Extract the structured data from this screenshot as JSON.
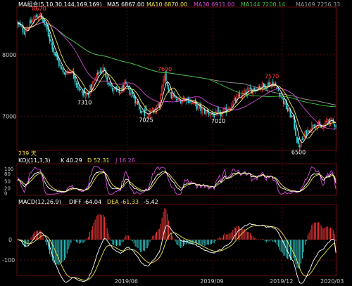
{
  "colors": {
    "up": "#ff3b3b",
    "down": "#36d1d1",
    "ma5": "#ffffff",
    "ma10": "#f0e44a",
    "ma30": "#d34bd3",
    "ma144": "#3fbf3f",
    "ma169": "#9a9a9a",
    "grid": "#5a0b0b",
    "axis_text": "#c8c8c8",
    "k": "#ffffff",
    "d": "#f0e44a",
    "j": "#d34bd3",
    "diff": "#ffffff",
    "dea": "#f0e44a",
    "peak_label": "#ff3b3b",
    "trough_label": "#ffffff"
  },
  "header": {
    "ma": {
      "title": "MA组合(5,10,30,144,169,169)",
      "ma5": "MA5 6867.00",
      "ma10": "MA10 6870.00",
      "ma30": "MA30 6911.00",
      "ma144": "MA144 7200.14",
      "ma169": "MA169 7256.33"
    },
    "kdj": {
      "title": "KDJ(11,3,3)",
      "k": "K 40.29",
      "d": "D 52.31",
      "j": "J 16.26"
    },
    "macd": {
      "title": "MACD(12,26,9)",
      "diff": "DIFF -64.04",
      "dea": "DEA -61.33",
      "macd": "-5.42"
    }
  },
  "bar_count_label": "239 天",
  "chart_data": [
    {
      "type": "candlestick",
      "panel": "price",
      "ylim": [
        6450,
        8750
      ],
      "yticks": [
        7000,
        8000
      ],
      "xticks": [
        "2019/06",
        "2019/09",
        "2019/12",
        "2020/03"
      ],
      "anchor_points": [
        {
          "t": 0,
          "v": 8500
        },
        {
          "t": 5,
          "v": 8380
        },
        {
          "t": 10,
          "v": 8520
        },
        {
          "t": 16,
          "v": 8670
        },
        {
          "t": 22,
          "v": 8400
        },
        {
          "t": 28,
          "v": 8000
        },
        {
          "t": 34,
          "v": 7700
        },
        {
          "t": 40,
          "v": 7750
        },
        {
          "t": 46,
          "v": 7450
        },
        {
          "t": 50,
          "v": 7310
        },
        {
          "t": 56,
          "v": 7500
        },
        {
          "t": 60,
          "v": 7700
        },
        {
          "t": 64,
          "v": 7780
        },
        {
          "t": 70,
          "v": 7450
        },
        {
          "t": 76,
          "v": 7380
        },
        {
          "t": 80,
          "v": 7500
        },
        {
          "t": 86,
          "v": 7350
        },
        {
          "t": 92,
          "v": 7100
        },
        {
          "t": 96,
          "v": 7025
        },
        {
          "t": 102,
          "v": 7100
        },
        {
          "t": 106,
          "v": 7200
        },
        {
          "t": 110,
          "v": 7690
        },
        {
          "t": 114,
          "v": 7350
        },
        {
          "t": 120,
          "v": 7250
        },
        {
          "t": 126,
          "v": 7300
        },
        {
          "t": 132,
          "v": 7200
        },
        {
          "t": 138,
          "v": 7100
        },
        {
          "t": 144,
          "v": 7050
        },
        {
          "t": 150,
          "v": 7010
        },
        {
          "t": 156,
          "v": 7100
        },
        {
          "t": 162,
          "v": 7250
        },
        {
          "t": 168,
          "v": 7350
        },
        {
          "t": 174,
          "v": 7420
        },
        {
          "t": 180,
          "v": 7480
        },
        {
          "t": 186,
          "v": 7500
        },
        {
          "t": 190,
          "v": 7570
        },
        {
          "t": 196,
          "v": 7380
        },
        {
          "t": 202,
          "v": 7100
        },
        {
          "t": 206,
          "v": 6950
        },
        {
          "t": 210,
          "v": 6500
        },
        {
          "t": 216,
          "v": 6750
        },
        {
          "t": 222,
          "v": 6900
        },
        {
          "t": 228,
          "v": 6800
        },
        {
          "t": 232,
          "v": 6950
        },
        {
          "t": 238,
          "v": 6867
        }
      ],
      "annotations": [
        {
          "t": 16,
          "v": 8670,
          "text": "8670",
          "kind": "peak"
        },
        {
          "t": 50,
          "v": 7310,
          "text": "7310",
          "kind": "trough"
        },
        {
          "t": 96,
          "v": 7025,
          "text": "7025",
          "kind": "trough"
        },
        {
          "t": 110,
          "v": 7690,
          "text": "7690",
          "kind": "peak"
        },
        {
          "t": 150,
          "v": 7010,
          "text": "7010",
          "kind": "trough"
        },
        {
          "t": 190,
          "v": 7570,
          "text": "7570",
          "kind": "peak"
        },
        {
          "t": 210,
          "v": 6500,
          "text": "6500",
          "kind": "trough"
        }
      ],
      "ma_latest": {
        "ma5": 6867.0,
        "ma10": 6870.0,
        "ma30": 6911.0,
        "ma144": 7200.14,
        "ma169": 7256.33
      }
    },
    {
      "type": "line",
      "panel": "kdj",
      "ylim": [
        -10,
        115
      ],
      "yticks": [
        0,
        20,
        50,
        80,
        100
      ],
      "latest": {
        "K": 40.29,
        "D": 52.31,
        "J": 16.26
      }
    },
    {
      "type": "bar+line",
      "panel": "macd",
      "ylim": [
        -175,
        165
      ],
      "yticks": [
        -100,
        0
      ],
      "latest": {
        "DIFF": -64.04,
        "DEA": -61.33,
        "MACD": -5.42
      }
    }
  ]
}
